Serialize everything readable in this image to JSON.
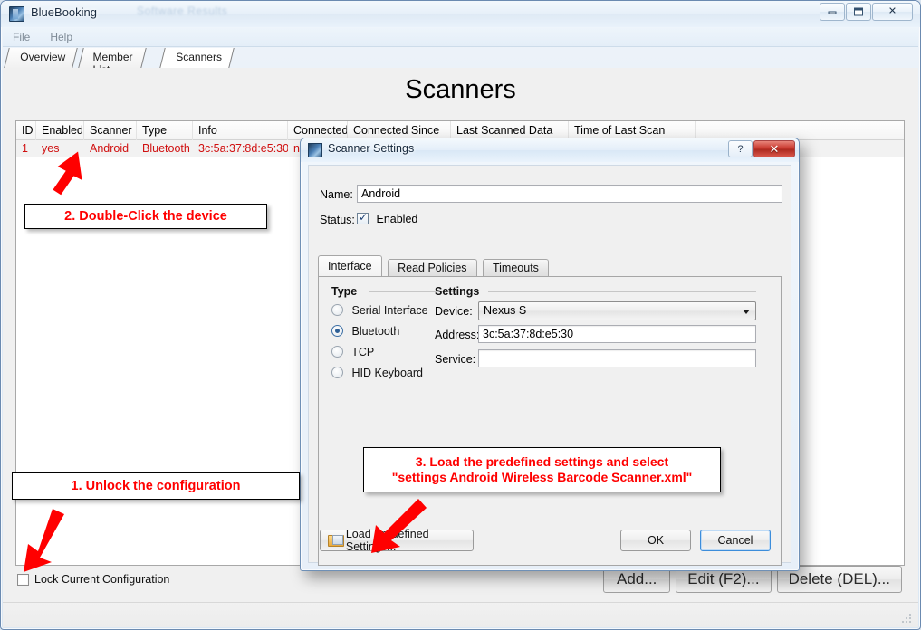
{
  "window": {
    "title": "BlueBooking",
    "ghost_text": "Software Results",
    "controls": [
      "minimize",
      "maximize",
      "close"
    ]
  },
  "menubar": {
    "items": [
      "File",
      "Help"
    ]
  },
  "tabs": [
    {
      "label": "Overview",
      "active": false
    },
    {
      "label": "Member List",
      "active": false
    },
    {
      "label": "Scanners",
      "active": true
    }
  ],
  "page": {
    "title": "Scanners"
  },
  "table": {
    "columns": [
      "ID",
      "Enabled",
      "Scanner",
      "Type",
      "Info",
      "Connected",
      "Connected Since",
      "Last Scanned Data",
      "Time of Last Scan"
    ],
    "rows": [
      {
        "id": "1",
        "enabled": "yes",
        "scanner": "Android",
        "type": "Bluetooth",
        "info": "3c:5a:37:8d:e5:30",
        "connected": "no",
        "connected_since": "",
        "last_scanned_data": "",
        "time_of_last_scan": ""
      }
    ],
    "row_text_color": "#d01010"
  },
  "bottom": {
    "lock_checkbox_label": "Lock Current Configuration",
    "lock_checked": false,
    "buttons": [
      "Add...",
      "Edit (F2)...",
      "Delete (DEL)..."
    ]
  },
  "dialog": {
    "title": "Scanner Settings",
    "help_button": "?",
    "close_button": "✕",
    "name_label": "Name:",
    "name_value": "Android",
    "status_label": "Status:",
    "status_checkbox_label": "Enabled",
    "status_checked": true,
    "tabs": [
      {
        "label": "Interface",
        "active": true
      },
      {
        "label": "Read Policies",
        "active": false
      },
      {
        "label": "Timeouts",
        "active": false
      }
    ],
    "type_group_label": "Type",
    "type_options": [
      {
        "label": "Serial Interface",
        "selected": false
      },
      {
        "label": "Bluetooth",
        "selected": true
      },
      {
        "label": "TCP",
        "selected": false
      },
      {
        "label": "HID Keyboard",
        "selected": false
      }
    ],
    "settings_group_label": "Settings",
    "device_label": "Device:",
    "device_value": "Nexus S",
    "address_label": "Address:",
    "address_value": "3c:5a:37:8d:e5:30",
    "service_label": "Service:",
    "service_value": "",
    "load_predefined_button": "Load Predefined Settings...",
    "ok_button": "OK",
    "cancel_button": "Cancel"
  },
  "annotations": [
    {
      "id": "step1",
      "text": "1. Unlock the configuration"
    },
    {
      "id": "step2",
      "text": "2. Double-Click the device"
    },
    {
      "id": "step3",
      "line1": "3. Load the predefined settings and select",
      "line2": "\"settings Android Wireless Barcode Scanner.xml\""
    }
  ],
  "colors": {
    "annotation_red": "#ff0000",
    "table_red": "#d01010",
    "title_text": "#1b2c40"
  }
}
